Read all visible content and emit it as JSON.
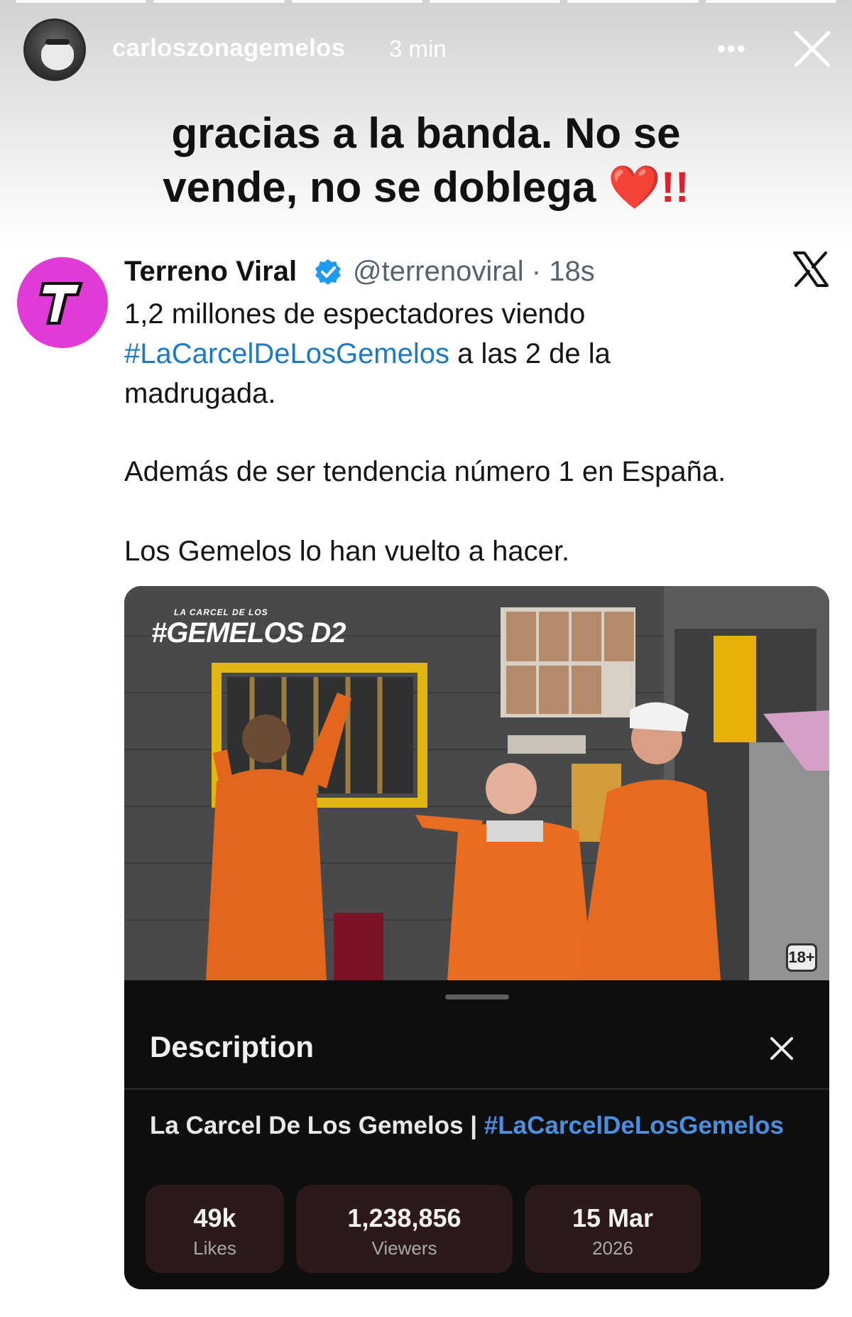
{
  "story": {
    "username": "carloszonagemelos",
    "time": "3 min",
    "more_label": "•••",
    "caption_line1": "gracias a la banda. No se",
    "caption_line2": "vende, no se doblega",
    "caption_emoji": "❤️",
    "caption_bangs": "!!"
  },
  "tweet": {
    "name": "Terreno Viral",
    "handle_time": "@terrenoviral · 18s",
    "avatar_letter": "t",
    "line1": "1,2 millones de espectadores viendo",
    "hashtag": "#LaCarcelDeLosGemelos",
    "line2_rest": "a las 2 de la",
    "line3": "madrugada.",
    "paragraph2": "Además de ser tendencia número 1 en España.",
    "paragraph3": "Los Gemelos lo han vuelto a hacer."
  },
  "media": {
    "logo_small": "LA CARCEL DE LOS",
    "logo_big": "#GEMELOS D2",
    "rating": "18+",
    "sheet_title": "Description",
    "desc_text": "La Carcel De Los Gemelos |",
    "desc_hashtag": "#LaCarcelDeLosGemelos",
    "stats": [
      {
        "value": "49k",
        "label": "Likes"
      },
      {
        "value": "1,238,856",
        "label": "Viewers"
      },
      {
        "value": "15 Mar",
        "label": "2026"
      }
    ]
  },
  "colors": {
    "hashtag": "#1d79c4",
    "avatar_bg": "#e23ad6",
    "stat_bg": "#2c1a1a",
    "verified": "#1d9bf0"
  }
}
